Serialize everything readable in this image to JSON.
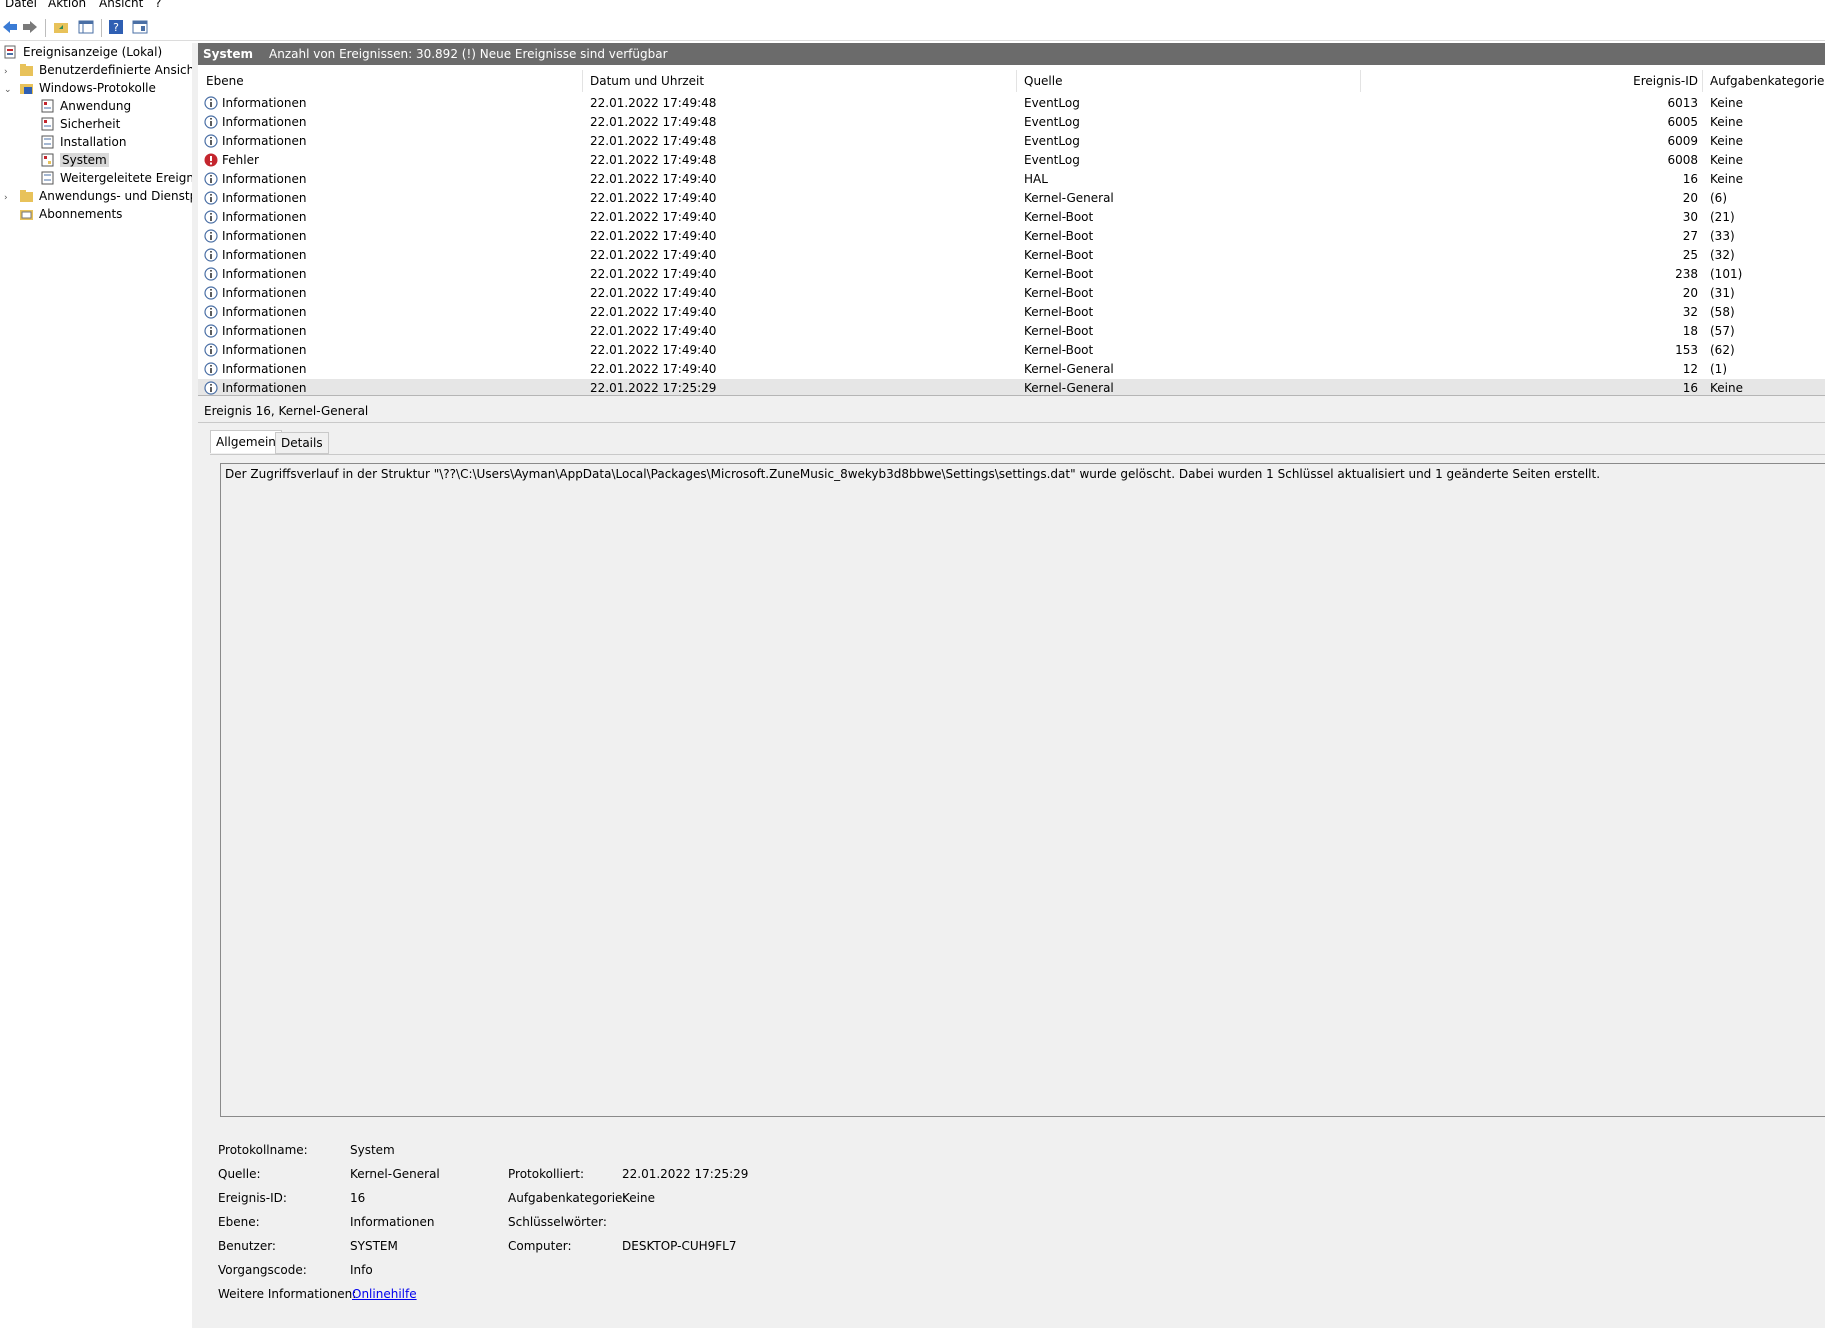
{
  "menu": {
    "items": [
      "Datei",
      "Aktion",
      "Ansicht",
      "?"
    ]
  },
  "toolbar": {
    "icons": [
      "back-arrow-icon",
      "forward-arrow-icon",
      "folder-up-icon",
      "show-hide-tree-icon",
      "help-icon",
      "properties-icon"
    ]
  },
  "tree": {
    "root": "Ereignisanzeige (Lokal)",
    "custom_views": "Benutzerdefinierte Ansichten",
    "windows_logs": "Windows-Protokolle",
    "logs": [
      "Anwendung",
      "Sicherheit",
      "Installation",
      "System",
      "Weitergeleitete Ereignisse"
    ],
    "app_services": "Anwendungs- und Dienstprotokolle",
    "subscriptions": "Abonnements"
  },
  "header": {
    "log_name": "System",
    "summary": "Anzahl von Ereignissen: 30.892 (!) Neue Ereignisse sind verfügbar"
  },
  "grid": {
    "columns": [
      "Ebene",
      "Datum und Uhrzeit",
      "Quelle",
      "Ereignis-ID",
      "Aufgabenkategorie"
    ],
    "rows": [
      {
        "level": "Informationen",
        "type": "info",
        "date": "22.01.2022 17:49:48",
        "source": "EventLog",
        "id": "6013",
        "category": "Keine"
      },
      {
        "level": "Informationen",
        "type": "info",
        "date": "22.01.2022 17:49:48",
        "source": "EventLog",
        "id": "6005",
        "category": "Keine"
      },
      {
        "level": "Informationen",
        "type": "info",
        "date": "22.01.2022 17:49:48",
        "source": "EventLog",
        "id": "6009",
        "category": "Keine"
      },
      {
        "level": "Fehler",
        "type": "error",
        "date": "22.01.2022 17:49:48",
        "source": "EventLog",
        "id": "6008",
        "category": "Keine"
      },
      {
        "level": "Informationen",
        "type": "info",
        "date": "22.01.2022 17:49:40",
        "source": "HAL",
        "id": "16",
        "category": "Keine"
      },
      {
        "level": "Informationen",
        "type": "info",
        "date": "22.01.2022 17:49:40",
        "source": "Kernel-General",
        "id": "20",
        "category": "(6)"
      },
      {
        "level": "Informationen",
        "type": "info",
        "date": "22.01.2022 17:49:40",
        "source": "Kernel-Boot",
        "id": "30",
        "category": "(21)"
      },
      {
        "level": "Informationen",
        "type": "info",
        "date": "22.01.2022 17:49:40",
        "source": "Kernel-Boot",
        "id": "27",
        "category": "(33)"
      },
      {
        "level": "Informationen",
        "type": "info",
        "date": "22.01.2022 17:49:40",
        "source": "Kernel-Boot",
        "id": "25",
        "category": "(32)"
      },
      {
        "level": "Informationen",
        "type": "info",
        "date": "22.01.2022 17:49:40",
        "source": "Kernel-Boot",
        "id": "238",
        "category": "(101)"
      },
      {
        "level": "Informationen",
        "type": "info",
        "date": "22.01.2022 17:49:40",
        "source": "Kernel-Boot",
        "id": "20",
        "category": "(31)"
      },
      {
        "level": "Informationen",
        "type": "info",
        "date": "22.01.2022 17:49:40",
        "source": "Kernel-Boot",
        "id": "32",
        "category": "(58)"
      },
      {
        "level": "Informationen",
        "type": "info",
        "date": "22.01.2022 17:49:40",
        "source": "Kernel-Boot",
        "id": "18",
        "category": "(57)"
      },
      {
        "level": "Informationen",
        "type": "info",
        "date": "22.01.2022 17:49:40",
        "source": "Kernel-Boot",
        "id": "153",
        "category": "(62)"
      },
      {
        "level": "Informationen",
        "type": "info",
        "date": "22.01.2022 17:49:40",
        "source": "Kernel-General",
        "id": "12",
        "category": "(1)"
      },
      {
        "level": "Informationen",
        "type": "info",
        "date": "22.01.2022 17:25:29",
        "source": "Kernel-General",
        "id": "16",
        "category": "Keine"
      }
    ]
  },
  "detail": {
    "title": "Ereignis 16, Kernel-General",
    "tabs": [
      "Allgemein",
      "Details"
    ],
    "message": "Der Zugriffsverlauf in der Struktur \"\\??\\C:\\Users\\Ayman\\AppData\\Local\\Packages\\Microsoft.ZuneMusic_8wekyb3d8bbwe\\Settings\\settings.dat\" wurde gelöscht. Dabei wurden 1 Schlüssel aktualisiert und 1 geänderte Seiten erstellt.",
    "labels": {
      "log_name": "Protokollname:",
      "source": "Quelle:",
      "event_id": "Ereignis-ID:",
      "level": "Ebene:",
      "user": "Benutzer:",
      "opcode": "Vorgangscode:",
      "more_info": "Weitere Informationen:",
      "logged": "Protokolliert:",
      "task_category": "Aufgabenkategorie:",
      "keywords": "Schlüsselwörter:",
      "computer": "Computer:"
    },
    "values": {
      "log_name": "System",
      "source": "Kernel-General",
      "event_id": "16",
      "level": "Informationen",
      "user": "SYSTEM",
      "opcode": "Info",
      "more_info_link": "Onlinehilfe",
      "logged": "22.01.2022 17:25:29",
      "task_category": "Keine",
      "keywords": "",
      "computer": "DESKTOP-CUH9FL7"
    }
  },
  "colors": {
    "title_bar": "#6b6b6b",
    "selection": "#e6e6e6",
    "link": "#0000ee",
    "error": "#c4262e",
    "info": "#4a6fa5"
  }
}
